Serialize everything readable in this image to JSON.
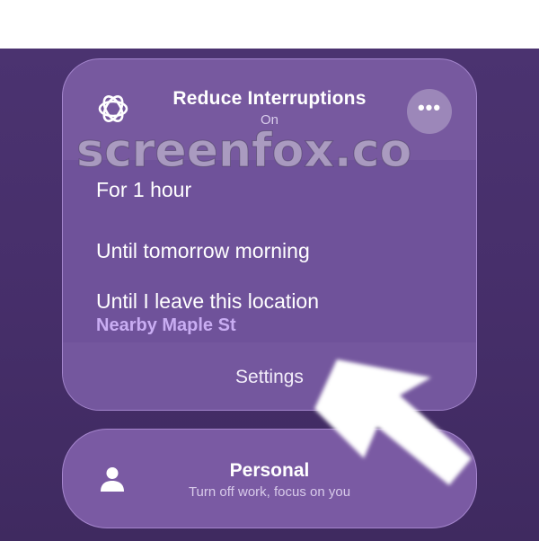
{
  "focus": {
    "title": "Reduce Interruptions",
    "status": "On",
    "more_icon": "ellipsis-icon",
    "mode_icon": "reduce-interruptions-icon",
    "options": [
      {
        "label": "For 1 hour"
      },
      {
        "label": "Until tomorrow morning"
      },
      {
        "label": "Until I leave this location",
        "detail": "Nearby Maple St"
      }
    ],
    "settings_label": "Settings"
  },
  "personal": {
    "title": "Personal",
    "subtitle": "Turn off work, focus on you",
    "icon": "person-icon"
  },
  "watermark": "screenfox.co",
  "colors": {
    "background": "#472f6b",
    "card": "#77599f",
    "accent": "#c9adf3"
  }
}
